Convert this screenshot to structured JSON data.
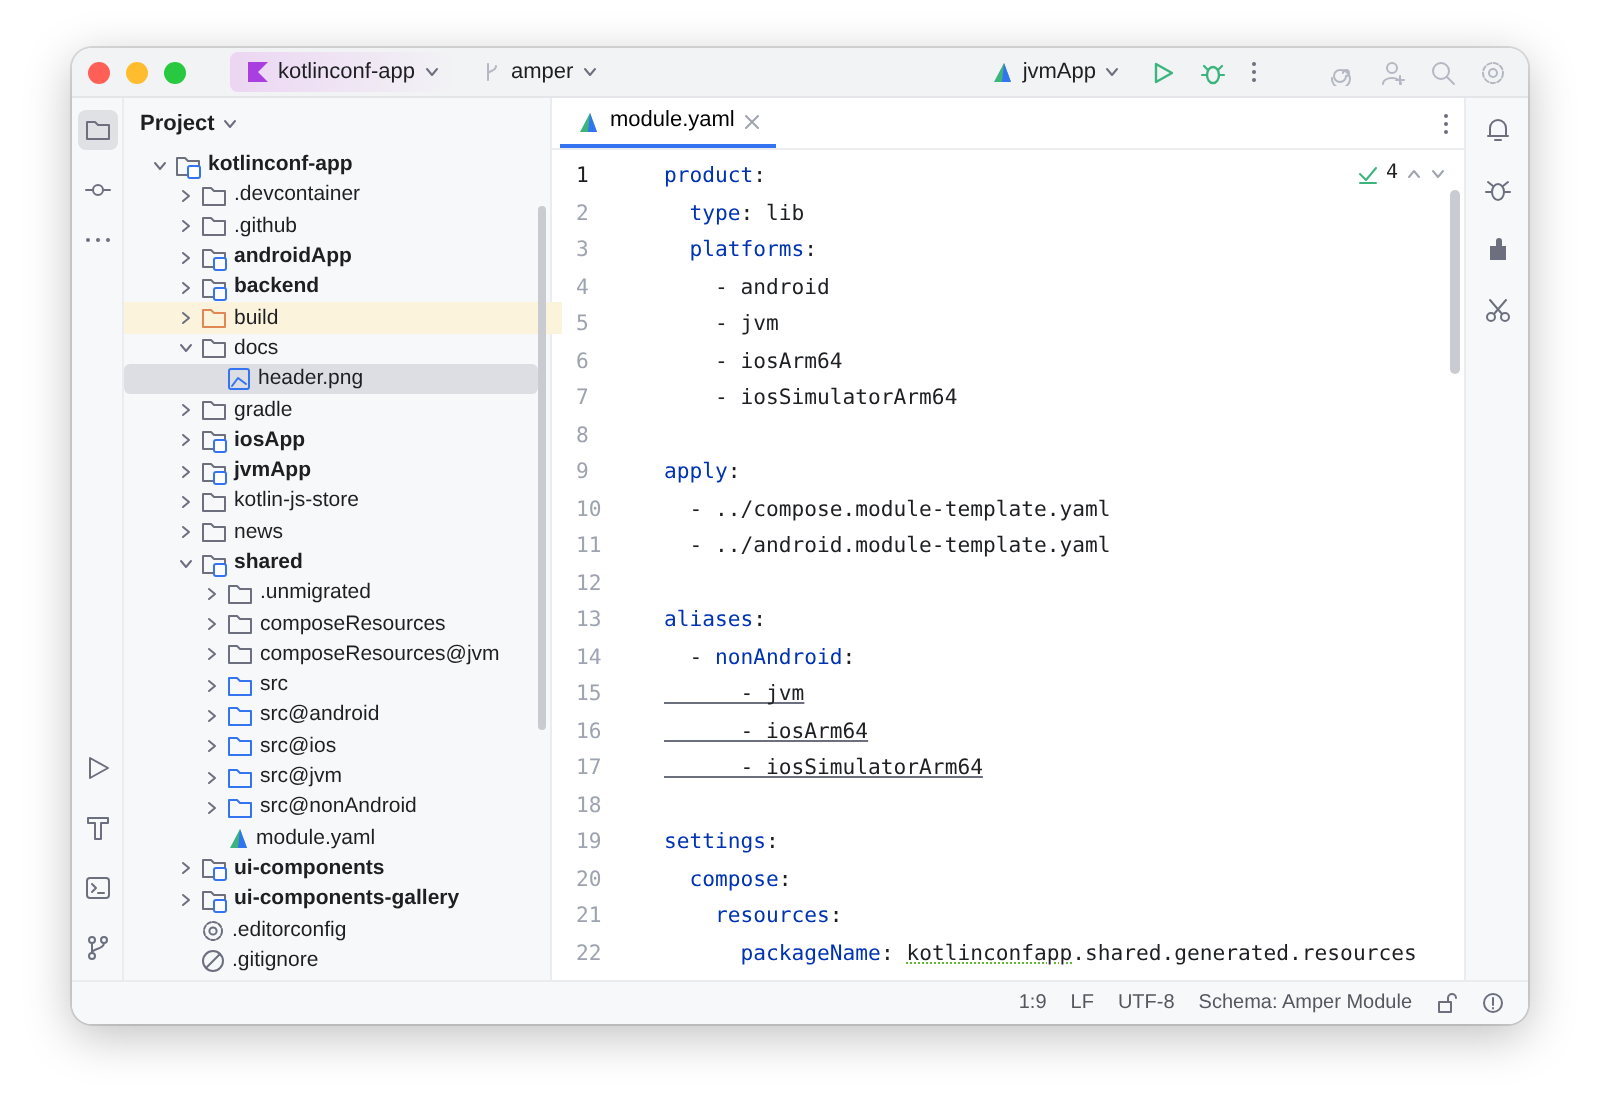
{
  "title_bar": {
    "project": "kotlinconf-app",
    "branch": "amper",
    "run_config": "jvmApp"
  },
  "project_panel": {
    "title": "Project",
    "tree": [
      {
        "name": "kotlinconf-app",
        "kind": "module",
        "expanded": true,
        "selected": false,
        "children": [
          {
            "name": ".devcontainer",
            "kind": "folder",
            "expanded": false,
            "selected": false
          },
          {
            "name": ".github",
            "kind": "folder",
            "expanded": false,
            "selected": false
          },
          {
            "name": "androidApp",
            "kind": "module",
            "expanded": false,
            "selected": false
          },
          {
            "name": "backend",
            "kind": "module",
            "expanded": false,
            "selected": false
          },
          {
            "name": "build",
            "kind": "excluded",
            "expanded": false,
            "selected": false
          },
          {
            "name": "docs",
            "kind": "folder",
            "expanded": true,
            "selected": false,
            "children": [
              {
                "name": "header.png",
                "kind": "image",
                "selected": true
              }
            ]
          },
          {
            "name": "gradle",
            "kind": "folder",
            "expanded": false,
            "selected": false
          },
          {
            "name": "iosApp",
            "kind": "module",
            "expanded": false,
            "selected": false
          },
          {
            "name": "jvmApp",
            "kind": "module",
            "expanded": false,
            "selected": false
          },
          {
            "name": "kotlin-js-store",
            "kind": "folder",
            "expanded": false,
            "selected": false
          },
          {
            "name": "news",
            "kind": "folder",
            "expanded": false,
            "selected": false
          },
          {
            "name": "shared",
            "kind": "module",
            "expanded": true,
            "selected": false,
            "children": [
              {
                "name": ".unmigrated",
                "kind": "folder",
                "expanded": false,
                "selected": false
              },
              {
                "name": "composeResources",
                "kind": "folder",
                "expanded": false,
                "selected": false
              },
              {
                "name": "composeResources@jvm",
                "kind": "folder",
                "expanded": false,
                "selected": false
              },
              {
                "name": "src",
                "kind": "source",
                "expanded": false,
                "selected": false
              },
              {
                "name": "src@android",
                "kind": "source",
                "expanded": false,
                "selected": false
              },
              {
                "name": "src@ios",
                "kind": "source",
                "expanded": false,
                "selected": false
              },
              {
                "name": "src@jvm",
                "kind": "source",
                "expanded": false,
                "selected": false
              },
              {
                "name": "src@nonAndroid",
                "kind": "source",
                "expanded": false,
                "selected": false
              },
              {
                "name": "module.yaml",
                "kind": "yaml",
                "selected": false
              }
            ]
          },
          {
            "name": "ui-components",
            "kind": "module",
            "expanded": false,
            "selected": false
          },
          {
            "name": "ui-components-gallery",
            "kind": "module",
            "expanded": false,
            "selected": false
          },
          {
            "name": ".editorconfig",
            "kind": "config",
            "selected": false
          },
          {
            "name": ".gitignore",
            "kind": "ignore",
            "selected": false
          }
        ]
      }
    ]
  },
  "editor": {
    "tabs": [
      {
        "label": "module.yaml",
        "selected": true
      }
    ],
    "inspection_count": "4",
    "lines": [
      {
        "number": "1",
        "tokens": [
          {
            "kind": "key",
            "text": "product"
          },
          {
            "kind": "plain",
            "text": ":"
          }
        ]
      },
      {
        "number": "2",
        "tokens": [
          {
            "kind": "key",
            "text": "  type"
          },
          {
            "kind": "plain",
            "text": ": lib"
          }
        ]
      },
      {
        "number": "3",
        "tokens": [
          {
            "kind": "key",
            "text": "  platforms"
          },
          {
            "kind": "plain",
            "text": ":"
          }
        ]
      },
      {
        "number": "4",
        "tokens": [
          {
            "kind": "plain",
            "text": "    - android"
          }
        ]
      },
      {
        "number": "5",
        "tokens": [
          {
            "kind": "plain",
            "text": "    - jvm"
          }
        ]
      },
      {
        "number": "6",
        "tokens": [
          {
            "kind": "plain",
            "text": "    - iosArm64"
          }
        ]
      },
      {
        "number": "7",
        "tokens": [
          {
            "kind": "plain",
            "text": "    - iosSimulatorArm64"
          }
        ]
      },
      {
        "number": "8"
      },
      {
        "number": "9",
        "tokens": [
          {
            "kind": "key",
            "text": "apply"
          },
          {
            "kind": "plain",
            "text": ":"
          }
        ]
      },
      {
        "number": "10",
        "tokens": [
          {
            "kind": "plain",
            "text": "  - ../compose.module-template.yaml"
          }
        ]
      },
      {
        "number": "11",
        "tokens": [
          {
            "kind": "plain",
            "text": "  - ../android.module-template.yaml"
          }
        ]
      },
      {
        "number": "12"
      },
      {
        "number": "13",
        "tokens": [
          {
            "kind": "key",
            "text": "aliases"
          },
          {
            "kind": "plain",
            "text": ":"
          }
        ]
      },
      {
        "number": "14",
        "tokens": [
          {
            "kind": "plain",
            "text": "  - "
          },
          {
            "kind": "key",
            "text": "nonAndroid"
          },
          {
            "kind": "plain",
            "text": ":"
          }
        ]
      },
      {
        "number": "15",
        "tokens": [
          {
            "kind": "warning",
            "text": "      - jvm"
          }
        ]
      },
      {
        "number": "16",
        "tokens": [
          {
            "kind": "warning",
            "text": "      - iosArm64"
          }
        ]
      },
      {
        "number": "17",
        "tokens": [
          {
            "kind": "warning",
            "text": "      - iosSimulatorArm64"
          }
        ]
      },
      {
        "number": "18"
      },
      {
        "number": "19",
        "tokens": [
          {
            "kind": "key",
            "text": "settings"
          },
          {
            "kind": "plain",
            "text": ":"
          }
        ]
      },
      {
        "number": "20",
        "tokens": [
          {
            "kind": "key",
            "text": "  compose"
          },
          {
            "kind": "plain",
            "text": ":"
          }
        ]
      },
      {
        "number": "21",
        "tokens": [
          {
            "kind": "key",
            "text": "    resources"
          },
          {
            "kind": "plain",
            "text": ":"
          }
        ]
      },
      {
        "number": "22",
        "tokens": [
          {
            "kind": "key",
            "text": "      packageName"
          },
          {
            "kind": "plain",
            "text": ": "
          },
          {
            "kind": "typo",
            "text": "kotlinconfapp"
          },
          {
            "kind": "plain",
            "text": ".shared.generated.resources"
          }
        ]
      }
    ]
  },
  "status_bar": {
    "position": "1:9",
    "line_separator": "LF",
    "encoding": "UTF-8",
    "schema": "Schema: Amper Module"
  }
}
